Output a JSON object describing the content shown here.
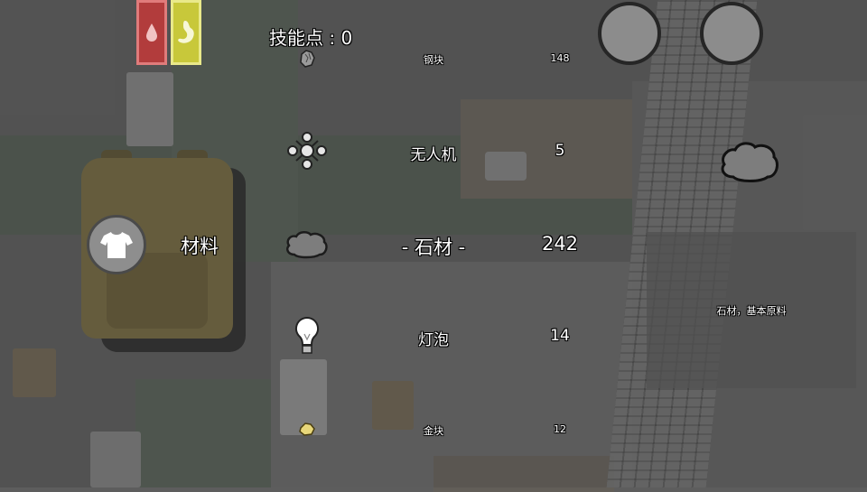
{
  "hud": {
    "skill_points_label": "技能点 : 0",
    "status_bars": [
      {
        "name": "blood",
        "color": "#b23c3c",
        "icon": "blood-drop-icon"
      },
      {
        "name": "hunger",
        "color": "#c8c83a",
        "icon": "stomach-icon"
      }
    ]
  },
  "inventory": {
    "category_label": "材料",
    "category_icon": "shirt-icon",
    "items": [
      {
        "name": "钢块",
        "quantity": "148",
        "icon": "steel-chunk-icon",
        "selected": false
      },
      {
        "name": "无人机",
        "quantity": "5",
        "icon": "drone-icon",
        "selected": false
      },
      {
        "name": "- 石材 -",
        "quantity": "242",
        "icon": "stone-icon",
        "selected": true
      },
      {
        "name": "灯泡",
        "quantity": "14",
        "icon": "lightbulb-icon",
        "selected": false
      },
      {
        "name": "金块",
        "quantity": "12",
        "icon": "gold-nugget-icon",
        "selected": false
      }
    ],
    "description": "石材，基本原料"
  },
  "colors": {
    "text": "#ffffff",
    "outline": "#000000",
    "stone": "#7d7d7d",
    "gold": "#e8d77a"
  }
}
